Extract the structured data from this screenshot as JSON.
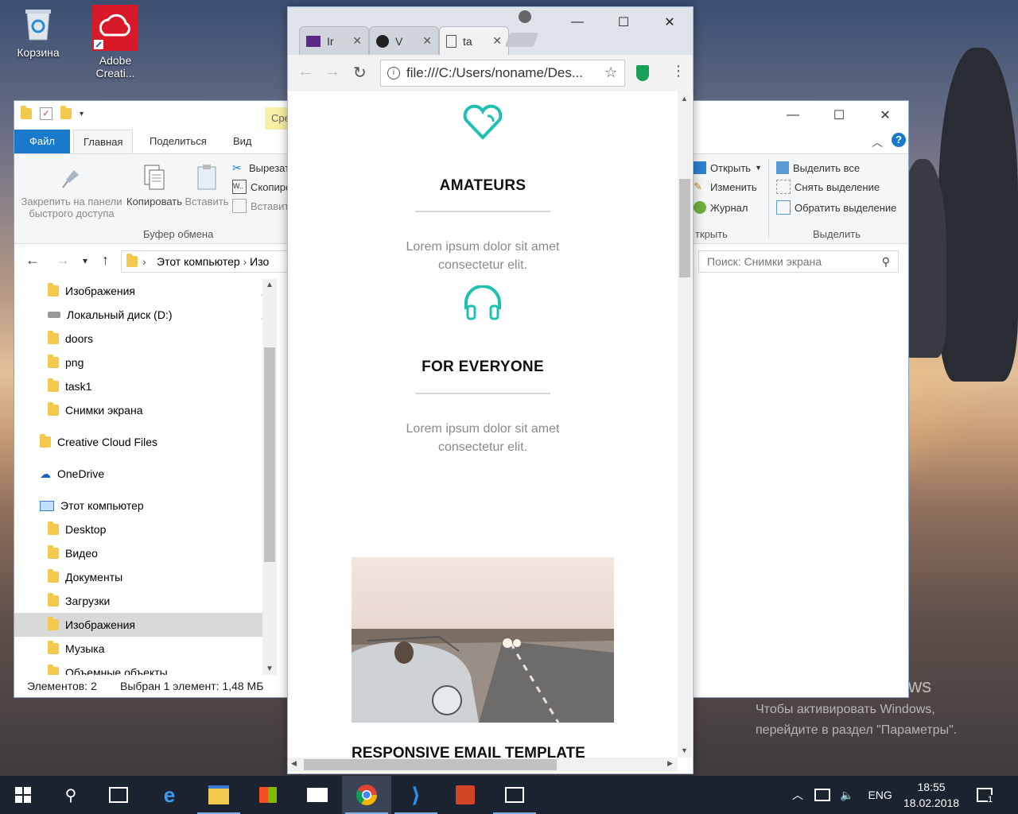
{
  "desktop": {
    "icons": [
      {
        "label": "Корзина"
      },
      {
        "label_line1": "Adobe",
        "label_line2": "Creati..."
      }
    ],
    "activation": {
      "title": "Активация Windows",
      "line1": "Чтобы активировать Windows,",
      "line2": "перейдите в раздел \"Параметры\"."
    }
  },
  "explorer": {
    "ribbon_tabs": [
      "Файл",
      "Главная",
      "Поделиться",
      "Вид"
    ],
    "yellow_tab": "Сре",
    "clipboard": {
      "pin_label_line1": "Закрепить на панели",
      "pin_label_line2": "быстрого доступа",
      "copy": "Копировать",
      "paste": "Вставить",
      "cut": "Вырезат",
      "copy_path": "Скопиро",
      "paste_shortcut": "Вставит",
      "group": "Буфер обмена"
    },
    "open_group": {
      "open": "Открыть",
      "edit": "Изменить",
      "history": "Журнал",
      "group": "ткрыть"
    },
    "select_group": {
      "select_all": "Выделить все",
      "select_none": "Снять выделение",
      "invert": "Обратить выделение",
      "group": "Выделить"
    },
    "address": {
      "part1": "Этот компьютер",
      "part2": "Изо"
    },
    "search_placeholder": "Поиск: Снимки экрана",
    "nav_items": [
      {
        "label": "Изображения"
      },
      {
        "label": "Локальный диск (D:)"
      },
      {
        "label": "doors"
      },
      {
        "label": "png"
      },
      {
        "label": "task1"
      },
      {
        "label": "Снимки экрана"
      },
      {
        "label": "Creative Cloud Files"
      },
      {
        "label": "OneDrive"
      },
      {
        "label": "Этот компьютер"
      },
      {
        "label": "Desktop"
      },
      {
        "label": "Видео"
      },
      {
        "label": "Документы"
      },
      {
        "label": "Загрузки"
      },
      {
        "label": "Изображения"
      },
      {
        "label": "Музыка"
      },
      {
        "label": "Объемные объекты"
      }
    ],
    "status": {
      "items": "Элементов: 2",
      "selected": "Выбран 1 элемент: 1,48 МБ"
    }
  },
  "chrome": {
    "tabs": [
      {
        "label": "Ir"
      },
      {
        "label": "V"
      },
      {
        "label": "ta"
      }
    ],
    "url": "file:///C:/Users/noname/Des...",
    "page": {
      "feature1_title": "AMATEURS",
      "feature1_text_line1": "Lorem ipsum dolor sit amet",
      "feature1_text_line2": "consectetur elit.",
      "feature2_title": "FOR EVERYONE",
      "feature2_text_line1": "Lorem ipsum dolor sit amet",
      "feature2_text_line2": "consectetur elit.",
      "teaser": "RESPONSIVE EMAIL TEMPLATE"
    },
    "accent": "#1ec1b0"
  },
  "taskbar": {
    "lang": "ENG",
    "time": "18:55",
    "date": "18.02.2018",
    "notifications": "1"
  }
}
